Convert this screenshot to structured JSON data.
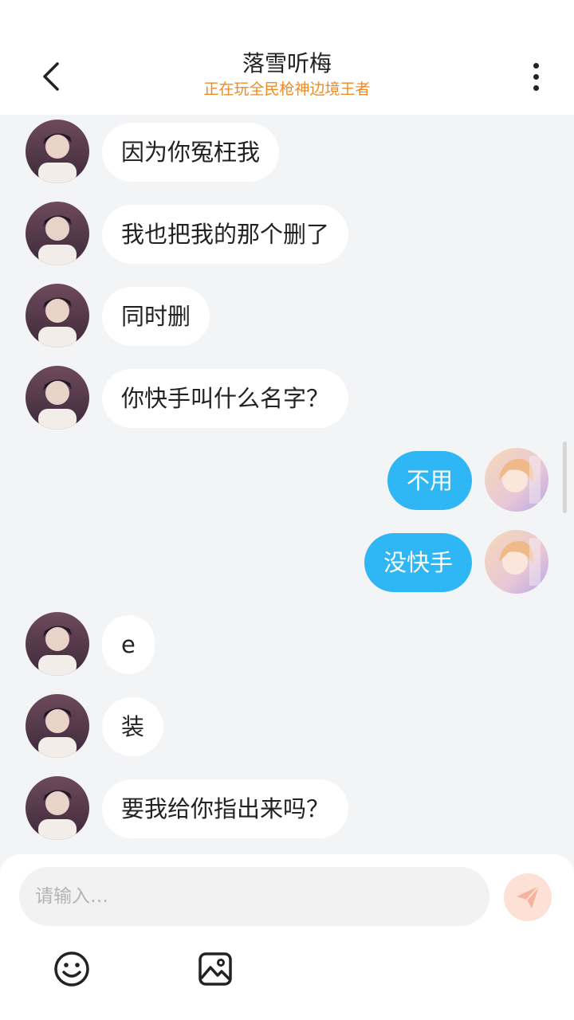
{
  "header": {
    "title": "落雪听梅",
    "subtitle": "正在玩全民枪神边境王者"
  },
  "messages": [
    {
      "side": "left",
      "text": "因为你冤枉我"
    },
    {
      "side": "left",
      "text": "我也把我的那个删了"
    },
    {
      "side": "left",
      "text": "同时删"
    },
    {
      "side": "left",
      "text": "你快手叫什么名字？"
    },
    {
      "side": "right",
      "text": "不用"
    },
    {
      "side": "right",
      "text": "没快手"
    },
    {
      "side": "left",
      "text": "e"
    },
    {
      "side": "left",
      "text": "装"
    },
    {
      "side": "left",
      "text": "要我给你指出来吗？"
    }
  ],
  "composer": {
    "placeholder": "请输入…"
  },
  "colors": {
    "accent_blue": "#2fb7f5",
    "subtitle_orange": "#f08a24",
    "send_inactive": "#fde0d6",
    "background": "#f3f4f6"
  },
  "icons": {
    "back": "chevron-left-icon",
    "more": "more-vertical-icon",
    "send": "paper-plane-icon",
    "emoji": "smiley-icon",
    "image": "image-icon"
  }
}
